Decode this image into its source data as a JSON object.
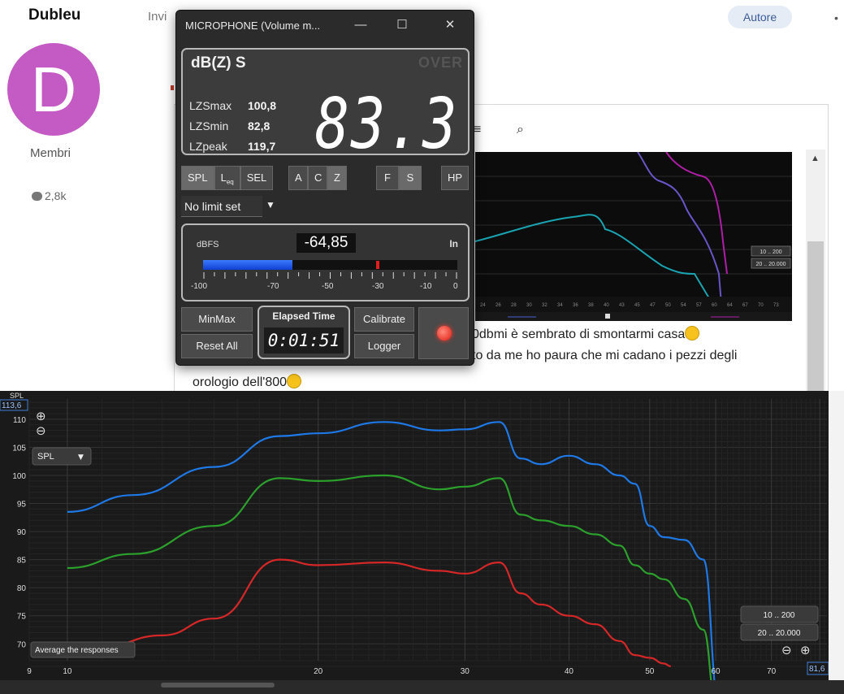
{
  "forum": {
    "username": "Dubleu",
    "avatar_letter": "D",
    "role": "Membri",
    "posts": "2,8k",
    "invite_text": "Invi",
    "author_badge": "Autore",
    "more": "•",
    "post_line1": "0dbmi è sembrato di smontarmi casa",
    "post_line2": "to da me ho paura che mi cadano i pezzi degli",
    "post_line3": "orologio dell'800"
  },
  "meter": {
    "title": "MICROPHONE (Volume m...",
    "mode": "dB(Z) S",
    "over": "OVER",
    "stats": [
      {
        "label": "LZSmax",
        "value": "100,8"
      },
      {
        "label": "LZSmin",
        "value": "82,8"
      },
      {
        "label": "LZpeak",
        "value": "119,7"
      }
    ],
    "reading": "83.3",
    "buttons": {
      "spl": "SPL",
      "leq": "L",
      "leq_sub": "eq",
      "sel": "SEL",
      "a": "A",
      "c": "C",
      "z": "Z",
      "f": "F",
      "s": "S",
      "hp": "HP"
    },
    "limit": "No limit set",
    "dbfs_label": "dBFS",
    "dbfs_value": "-64,85",
    "input_label": "In",
    "level_fraction": 0.35,
    "peak_fraction": 0.68,
    "scale": [
      "-100",
      "-70",
      "-50",
      "-30",
      "-10",
      "0"
    ],
    "minmax": "MinMax",
    "reset": "Reset All",
    "elapsed_label": "Elapsed Time",
    "elapsed_value": "0:01:51",
    "calibrate": "Calibrate",
    "logger": "Logger",
    "colors": {
      "level": "#2a5ff0",
      "record": "#e01a10"
    }
  },
  "chart_data": {
    "type": "line",
    "ylabel": "SPL",
    "ylim": [
      67,
      113.6
    ],
    "y_top_readout": "113,6",
    "x_right_readout": "81,6",
    "y_ticks": [
      70,
      75,
      80,
      85,
      90,
      95,
      100,
      105,
      110
    ],
    "x_ticks": [
      9,
      10,
      20,
      30,
      40,
      50,
      60,
      70
    ],
    "x_scale": "log",
    "xlim": [
      9,
      81.6
    ],
    "dropdown": "SPL",
    "average_button": "Average the responses",
    "range_buttons": [
      "10 .. 200",
      "20 .. 20.000"
    ],
    "zoom_in": "⊕",
    "zoom_out": "⊖",
    "series": [
      {
        "color": "#1e78e6",
        "x": [
          10,
          12,
          15,
          18,
          20,
          24,
          28,
          30,
          33,
          35,
          37,
          40,
          43,
          46,
          48,
          50,
          52,
          55,
          58,
          60.5
        ],
        "y": [
          93.5,
          96.5,
          101.5,
          107,
          107.5,
          109.5,
          108,
          108.2,
          109.5,
          103,
          102,
          103.5,
          102,
          100,
          98.5,
          91,
          89,
          88.5,
          85,
          60
        ]
      },
      {
        "color": "#2ca02c",
        "x": [
          10,
          12,
          15,
          18,
          20,
          24,
          28,
          30,
          33,
          35,
          37,
          40,
          43,
          46,
          48,
          50,
          52,
          55,
          58,
          60
        ],
        "y": [
          83.5,
          86,
          91,
          99.5,
          99,
          100,
          97.5,
          98,
          99.5,
          93,
          92,
          91,
          89.5,
          87.5,
          84,
          82.5,
          81.5,
          78,
          72.5,
          60
        ]
      },
      {
        "color": "#d62728",
        "x": [
          11,
          13,
          15,
          18,
          20,
          24,
          28,
          30,
          33,
          35,
          37,
          40,
          43,
          46,
          48,
          50,
          52,
          53
        ],
        "y": [
          69.5,
          71.5,
          74.5,
          85,
          84,
          84.5,
          83,
          82.5,
          84.5,
          79,
          77,
          75,
          73.5,
          70.5,
          68,
          67.5,
          66.5,
          66
        ]
      }
    ]
  },
  "forum_image": {
    "label_a": "10 .. 200",
    "label_b": "20 .. 20.000",
    "ticks": [
      "24",
      "26",
      "28",
      "30",
      "32",
      "34",
      "36",
      "38",
      "40",
      "43",
      "45",
      "47",
      "50",
      "54",
      "57",
      "60",
      "64",
      "67",
      "70",
      "73"
    ]
  }
}
